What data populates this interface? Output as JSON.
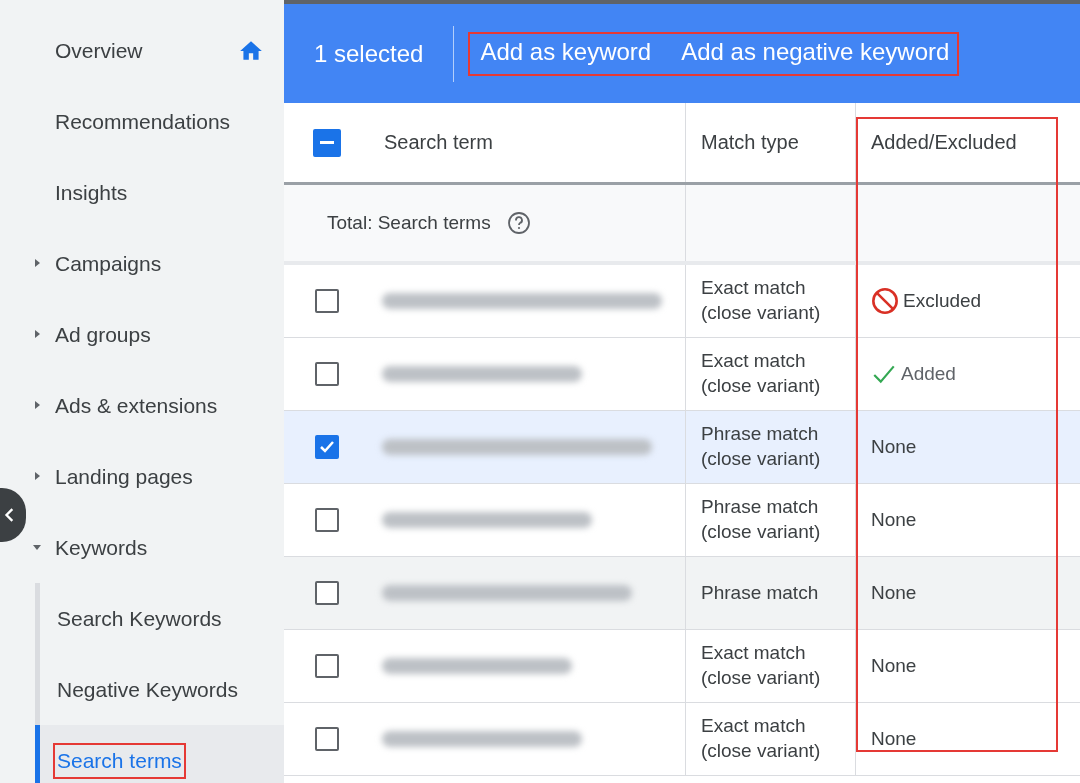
{
  "sidebar": {
    "items": [
      {
        "label": "Overview",
        "kind": "home",
        "selected": false
      },
      {
        "label": "Recommendations",
        "kind": "plain",
        "selected": false
      },
      {
        "label": "Insights",
        "kind": "plain",
        "selected": false
      },
      {
        "label": "Campaigns",
        "kind": "group",
        "expanded": false,
        "selected": false
      },
      {
        "label": "Ad groups",
        "kind": "group",
        "expanded": false,
        "selected": false
      },
      {
        "label": "Ads & extensions",
        "kind": "group",
        "expanded": false,
        "selected": false
      },
      {
        "label": "Landing pages",
        "kind": "group",
        "expanded": false,
        "selected": false
      },
      {
        "label": "Keywords",
        "kind": "group",
        "expanded": true,
        "selected": false,
        "children": [
          {
            "label": "Search Keywords",
            "selected": false,
            "highlighted": false
          },
          {
            "label": "Negative Keywords",
            "selected": false,
            "highlighted": false
          },
          {
            "label": "Search terms",
            "selected": true,
            "highlighted": true
          }
        ]
      }
    ]
  },
  "action_bar": {
    "selection": "1 selected",
    "highlighted": true,
    "actions": [
      "Add as keyword",
      "Add as negative keyword"
    ]
  },
  "table": {
    "header_checkbox": {
      "indeterminate": true
    },
    "columns": [
      {
        "label": "Search term"
      },
      {
        "label": "Match type"
      },
      {
        "label": "Added/Excluded",
        "highlighted": true
      }
    ],
    "total_label": "Total: Search terms",
    "rows": [
      {
        "checked": false,
        "hovered": false,
        "match_type": [
          "Exact match",
          "(close variant)"
        ],
        "status": {
          "kind": "excluded",
          "label": "Excluded"
        }
      },
      {
        "checked": false,
        "hovered": false,
        "match_type": [
          "Exact match",
          "(close variant)"
        ],
        "status": {
          "kind": "added",
          "label": "Added"
        }
      },
      {
        "checked": true,
        "hovered": false,
        "match_type": [
          "Phrase match",
          "(close variant)"
        ],
        "status": {
          "kind": "none",
          "label": "None"
        }
      },
      {
        "checked": false,
        "hovered": false,
        "match_type": [
          "Phrase match",
          "(close variant)"
        ],
        "status": {
          "kind": "none",
          "label": "None"
        }
      },
      {
        "checked": false,
        "hovered": true,
        "match_type": [
          "Phrase match"
        ],
        "status": {
          "kind": "none",
          "label": "None"
        }
      },
      {
        "checked": false,
        "hovered": false,
        "match_type": [
          "Exact match",
          "(close variant)"
        ],
        "status": {
          "kind": "none",
          "label": "None"
        }
      },
      {
        "checked": false,
        "hovered": false,
        "match_type": [
          "Exact match",
          "(close variant)"
        ],
        "status": {
          "kind": "none",
          "label": "None"
        }
      }
    ]
  }
}
